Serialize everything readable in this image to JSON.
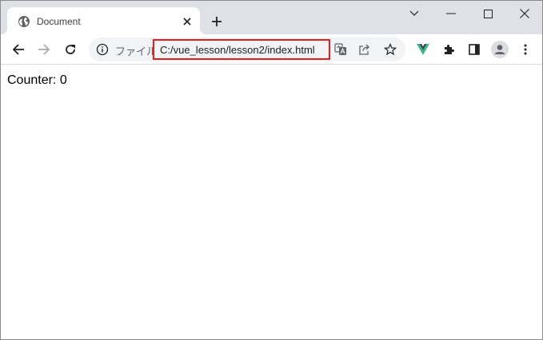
{
  "tab": {
    "title": "Document",
    "favicon": "globe-icon"
  },
  "window_controls": [
    "chevron-down-icon",
    "minimize-icon",
    "maximize-icon",
    "close-icon"
  ],
  "omnibox": {
    "scheme_label": "ファイル",
    "url": "C:/vue_lesson/lesson2/index.html",
    "highlight_color": "#e02020"
  },
  "toolbar_icons": [
    "back-icon",
    "forward-icon",
    "reload-icon",
    "translate-icon",
    "share-icon",
    "star-icon",
    "vue-devtools-icon",
    "extensions-icon",
    "side-panel-icon",
    "profile-icon",
    "menu-icon"
  ],
  "page": {
    "counter_label": "Counter:",
    "counter_value": "0"
  },
  "colors": {
    "chrome_bg": "#dee1e6",
    "omnibox_bg": "#f1f3f4",
    "vue_green": "#41b883"
  }
}
